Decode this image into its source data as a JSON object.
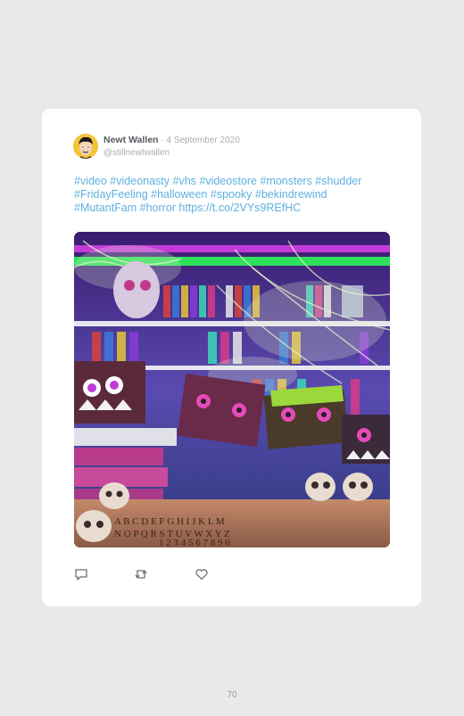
{
  "tweet": {
    "author_name": "Newt Wallen",
    "date": "· 4 September 2020",
    "handle": "@stillnewtwallen",
    "text_line1": "#video #videonasty #vhs #videostore #monsters #shudder",
    "text_line2": "#FridayFeeling #halloween #spooky #bekindrewind",
    "text_line3": "#MutantFam #horror https://t.co/2VYs9REfHC",
    "photo_icon": "halloween-videostore-photo",
    "actions": {
      "reply_icon": "reply-icon",
      "retweet_icon": "retweet-icon",
      "like_icon": "heart-icon"
    }
  },
  "page_number": "70",
  "colors": {
    "background": "#e9e9e7",
    "card": "#ffffff",
    "link": "#5fb0e0",
    "name": "#555a60",
    "muted": "#a9aeb3"
  }
}
